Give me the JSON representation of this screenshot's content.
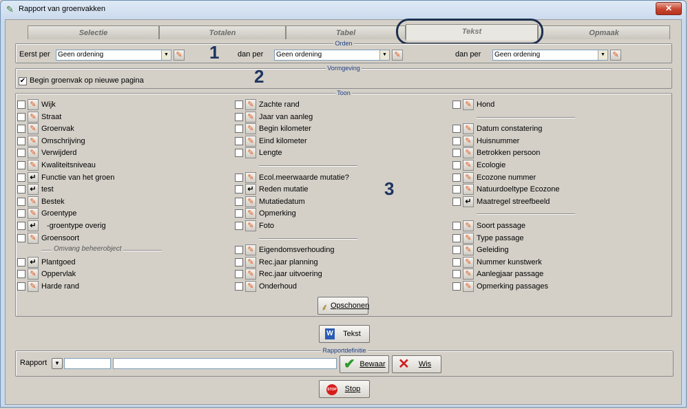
{
  "window": {
    "title": "Rapport van groenvakken",
    "close_label": "✕"
  },
  "tabs": [
    {
      "label": "Selectie"
    },
    {
      "label": "Totalen"
    },
    {
      "label": "Tabel"
    },
    {
      "label": "Tekst"
    },
    {
      "label": "Opmaak"
    }
  ],
  "orden": {
    "legend": "Orden",
    "first_label": "Eerst per",
    "then_label": "dan per",
    "then_label2": "dan per",
    "combo1": "Geen ordening",
    "combo2": "Geen ordening",
    "combo3": "Geen ordening"
  },
  "vormgeving": {
    "legend": "Vormgeving",
    "new_page_label": "Begin groenvak op nieuwe pagina",
    "new_page_checked": true
  },
  "toon": {
    "legend": "Toon",
    "col1": [
      "Wijk",
      "Straat",
      "Groenvak",
      "Omschrijving",
      "Verwijderd",
      "Kwaliteitsniveau",
      "Functie van het groen",
      "test",
      "Bestek",
      "Groentype",
      "-groentype overig",
      "Groensoort"
    ],
    "omvang_header": "Omvang beheerobject",
    "col1b": [
      "Plantgoed",
      "Oppervlak",
      "Harde rand"
    ],
    "col2a": [
      "Zachte rand",
      "Jaar van aanleg",
      "Begin kilometer",
      "Eind kilometer",
      "Lengte"
    ],
    "col2b": [
      "Ecol.meerwaarde mutatie?",
      "Reden mutatie",
      "Mutatiedatum",
      "Opmerking",
      "Foto"
    ],
    "col2c": [
      "Eigendomsverhouding",
      "Rec.jaar planning",
      "Rec.jaar uitvoering",
      "Onderhoud"
    ],
    "col3a": [
      "Hond"
    ],
    "col3b": [
      "Datum constatering",
      "Huisnummer",
      "Betrokken persoon",
      "Ecologie",
      "Ecozone nummer",
      "Natuurdoeltype Ecozone",
      "Maatregel streefbeeld"
    ],
    "col3c": [
      "Soort passage",
      "Type passage",
      "Geleiding",
      "Nummer kunstwerk",
      "Aanlegjaar passage",
      "Opmerking passages"
    ],
    "clean_button": "Opschonen"
  },
  "tekst_button": "Tekst",
  "rapportdef": {
    "legend": "Rapportdefinitie",
    "label": "Rapport",
    "save": "Bewaar",
    "delete": "Wis"
  },
  "stop_button": "Stop",
  "annotations": [
    "1",
    "2",
    "3"
  ]
}
